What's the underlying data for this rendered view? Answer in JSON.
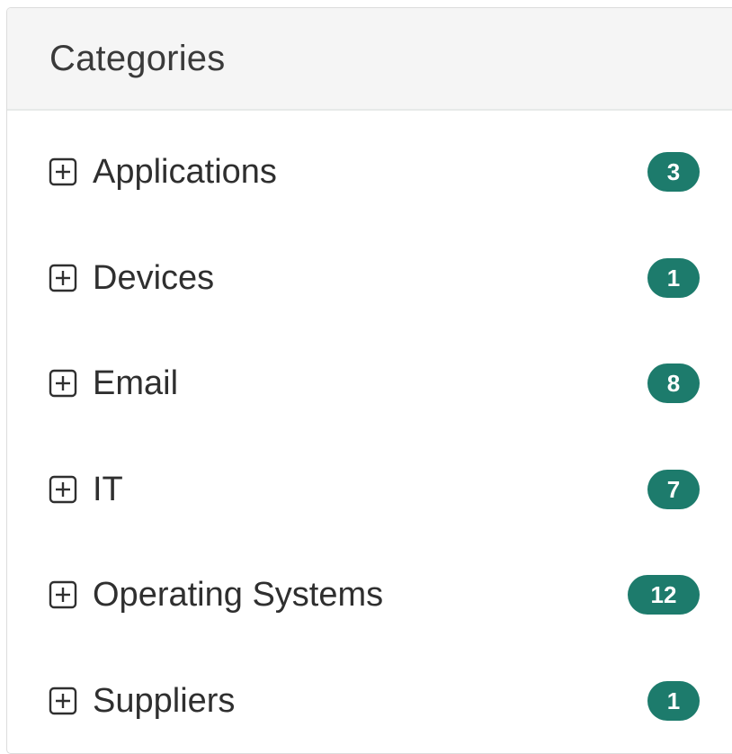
{
  "panel": {
    "title": "Categories"
  },
  "categories": [
    {
      "label": "Applications",
      "count": "3",
      "icon": "expand-plus-icon"
    },
    {
      "label": "Devices",
      "count": "1",
      "icon": "expand-plus-icon"
    },
    {
      "label": "Email",
      "count": "8",
      "icon": "expand-plus-icon"
    },
    {
      "label": "IT",
      "count": "7",
      "icon": "expand-plus-icon"
    },
    {
      "label": "Operating Systems",
      "count": "12",
      "icon": "expand-plus-icon"
    },
    {
      "label": "Suppliers",
      "count": "1",
      "icon": "expand-plus-icon"
    }
  ],
  "colors": {
    "badge": "#1d7b6c",
    "header_bg": "#f5f5f5",
    "text": "#2f2f2f"
  }
}
